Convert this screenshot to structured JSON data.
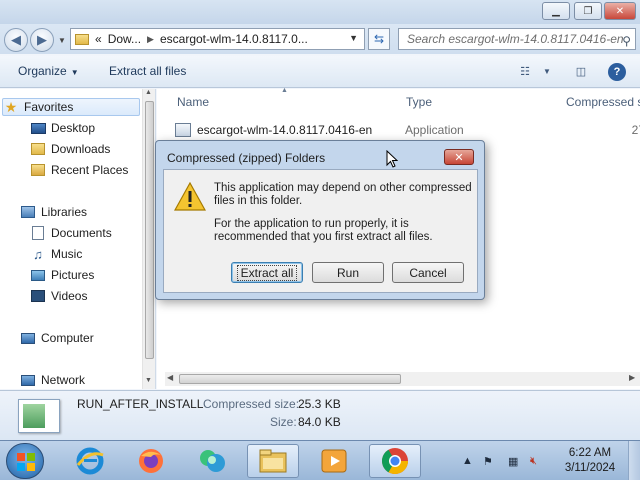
{
  "window": {
    "breadcrumb": {
      "overflow": "«",
      "parent": "Dow...",
      "current": "escargot-wlm-14.0.8117.0..."
    },
    "search_placeholder": "Search escargot-wlm-14.0.8117.0416-en"
  },
  "commandbar": {
    "organize": "Organize",
    "extract_all_files": "Extract all files"
  },
  "navpane": {
    "items": [
      {
        "label": "Favorites",
        "icon": "star-icon"
      },
      {
        "label": "Desktop",
        "icon": "desktop-icon"
      },
      {
        "label": "Downloads",
        "icon": "downloads-folder-icon"
      },
      {
        "label": "Recent Places",
        "icon": "recent-places-icon"
      },
      {
        "label": "Libraries",
        "icon": "libraries-icon"
      },
      {
        "label": "Documents",
        "icon": "documents-icon"
      },
      {
        "label": "Music",
        "icon": "music-icon"
      },
      {
        "label": "Pictures",
        "icon": "pictures-icon"
      },
      {
        "label": "Videos",
        "icon": "videos-icon"
      },
      {
        "label": "Computer",
        "icon": "computer-icon"
      },
      {
        "label": "Network",
        "icon": "network-icon"
      }
    ]
  },
  "filelist": {
    "columns": [
      "Name",
      "Type",
      "Compressed s"
    ],
    "rows": [
      {
        "name": "escargot-wlm-14.0.8117.0416-en",
        "type": "Application",
        "compressed": "27"
      }
    ]
  },
  "details": {
    "filename": "RUN_AFTER_INSTALL",
    "compressed_label": "Compressed size:",
    "compressed_value": "25.3 KB",
    "size_label": "Size:",
    "size_value": "84.0 KB"
  },
  "dialog": {
    "title": "Compressed (zipped) Folders",
    "message1": "This application may depend on other compressed files in this folder.",
    "message2": "For the application to run properly, it is recommended that you first extract all files.",
    "buttons": {
      "extract_all": "Extract all",
      "run": "Run",
      "cancel": "Cancel"
    }
  },
  "taskbar": {
    "apps": [
      "internet-explorer-icon",
      "firefox-icon",
      "messenger-icon",
      "file-explorer-icon",
      "media-player-icon",
      "chrome-icon"
    ],
    "clock_time": "6:22 AM",
    "clock_date": "3/11/2024"
  },
  "colors": {
    "accent": "#2c66b1",
    "dialog_frame": "#c3d6ec",
    "close_red": "#c74636"
  }
}
